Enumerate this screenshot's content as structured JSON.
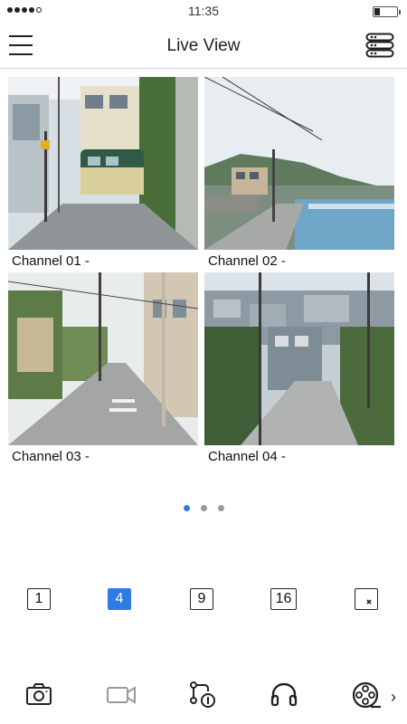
{
  "status_bar": {
    "time": "11:35"
  },
  "header": {
    "title": "Live View"
  },
  "channels": [
    {
      "label": "Channel 01 -"
    },
    {
      "label": "Channel 02 -"
    },
    {
      "label": "Channel 03 -"
    },
    {
      "label": "Channel 04 -"
    }
  ],
  "pagination": {
    "pages": 3,
    "active": 1
  },
  "layouts": [
    {
      "label": "1"
    },
    {
      "label": "4",
      "active": true
    },
    {
      "label": "9"
    },
    {
      "label": "16"
    }
  ],
  "colors": {
    "accent": "#2e7be6"
  },
  "toolbar": {
    "icons": [
      "snapshot-icon",
      "record-icon",
      "playback-icon",
      "talk-icon",
      "film-reel-icon"
    ]
  }
}
